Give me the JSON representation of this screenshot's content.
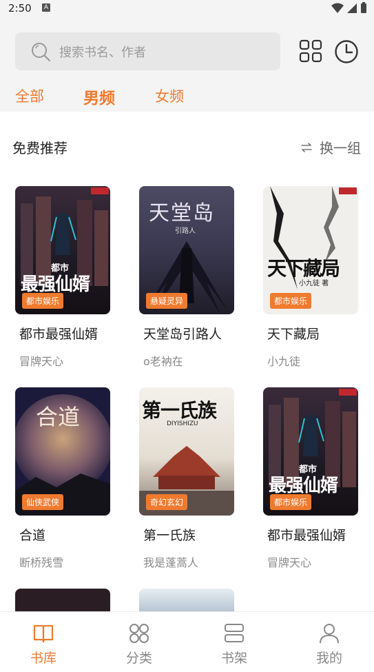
{
  "status_bar": {
    "time": "2:50",
    "notification_letter": "A"
  },
  "search": {
    "placeholder": "搜索书名、作者"
  },
  "tabs": [
    {
      "label": "全部",
      "active": false
    },
    {
      "label": "男频",
      "active": true
    },
    {
      "label": "女频",
      "active": false
    }
  ],
  "section": {
    "title": "免费推荐",
    "refresh_label": "换一组"
  },
  "books": [
    {
      "title": "都市最强仙婿",
      "author": "冒牌天心",
      "badge": "都市娱乐",
      "cover_text": "最强仙婿",
      "cover_top": "都市"
    },
    {
      "title": "天堂岛引路人",
      "author": "o老衲在",
      "badge": "悬疑灵异",
      "cover_text": "天堂岛",
      "cover_top": "引路人"
    },
    {
      "title": "天下藏局",
      "author": "小九徒",
      "badge": "都市娱乐",
      "cover_text": "天下藏局",
      "cover_top": "小九徒 著"
    },
    {
      "title": "合道",
      "author": "断桥残雪",
      "badge": "仙侠武侠",
      "cover_text": "合道",
      "cover_top": ""
    },
    {
      "title": "第一氏族",
      "author": "我是蓬蒿人",
      "badge": "奇幻玄幻",
      "cover_text": "第一氏族",
      "cover_top": "DIYISHIZU"
    },
    {
      "title": "都市最强仙婿",
      "author": "冒牌天心",
      "badge": "都市娱乐",
      "cover_text": "最强仙婿",
      "cover_top": "都市"
    }
  ],
  "bottom_nav": [
    {
      "label": "书库",
      "icon": "book-open-icon",
      "active": true
    },
    {
      "label": "分类",
      "icon": "category-grid-icon",
      "active": false
    },
    {
      "label": "书架",
      "icon": "bookshelf-icon",
      "active": false
    },
    {
      "label": "我的",
      "icon": "user-icon",
      "active": false
    }
  ],
  "colors": {
    "accent": "#f07a2e",
    "header_bg": "#f4f4f4",
    "search_bg": "#e7e7e7"
  }
}
